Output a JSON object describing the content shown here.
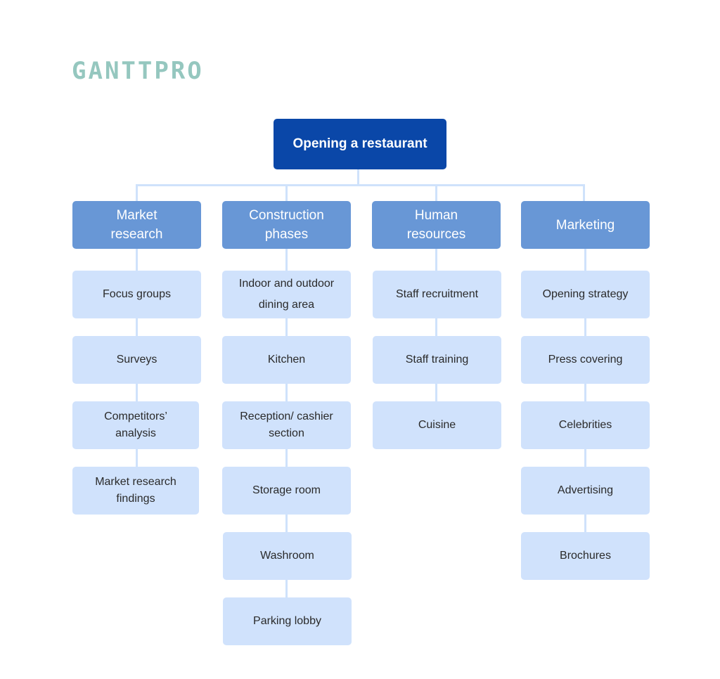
{
  "logo": {
    "text": "GANTTPRO",
    "color": "#95c7bf"
  },
  "colors": {
    "root": "#0a47a8",
    "category": "#6897d6",
    "leaf": "#d0e2fc",
    "connector": "#cfe2fb"
  },
  "root": {
    "label": "Opening a restaurant"
  },
  "categories": [
    {
      "label": "Market\nresearch",
      "children": [
        "Focus groups",
        "Surveys",
        "Competitors’\nanalysis",
        "Market research\nfindings"
      ]
    },
    {
      "label": "Construction\nphases",
      "children": [
        "Indoor and outdoor\ndining area",
        "Kitchen",
        "Reception/ cashier\nsection",
        "Storage room",
        "Washroom",
        "Parking lobby"
      ]
    },
    {
      "label": "Human\nresources",
      "children": [
        "Staff recruitment",
        "Staff training",
        "Cuisine"
      ]
    },
    {
      "label": "Marketing",
      "children": [
        "Opening strategy",
        "Press covering",
        "Celebrities",
        "Advertising",
        "Brochures"
      ]
    }
  ]
}
